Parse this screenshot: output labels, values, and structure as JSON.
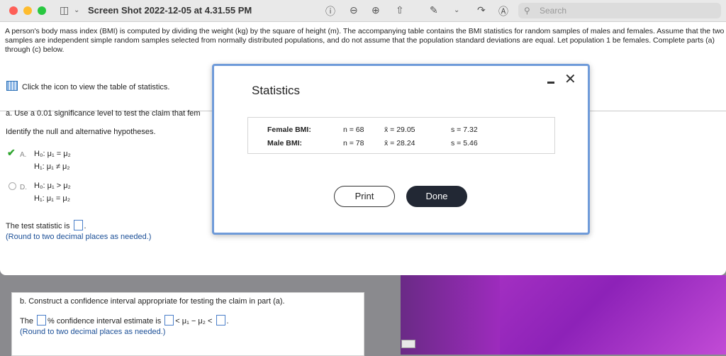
{
  "window": {
    "title": "Screen Shot 2022-12-05 at 4.31.55 PM",
    "search_placeholder": "Search"
  },
  "colors": {
    "close": "#fe5f57",
    "minimize": "#febc2e",
    "zoom": "#28c840"
  },
  "icons": [
    "sidebar-icon",
    "chevron-down-icon",
    "info-icon",
    "zoom-out-icon",
    "zoom-in-icon",
    "share-icon",
    "markup-icon",
    "rotate-icon",
    "annotate-icon",
    "search-icon"
  ],
  "intro": "A person's body mass index (BMI) is computed by dividing the weight (kg) by the square of height (m). The accompanying table contains the BMI statistics for random samples of males and females. Assume that the two samples are independent simple random samples selected from normally distributed populations, and do not assume that the population standard deviations are equal. Let population 1 be females. Complete parts (a) through (c) below.",
  "icon_link": "Click the icon to view the table of statistics.",
  "part_a": {
    "prompt": "a. Use a 0.01 significance level to test the claim that fem",
    "identify": "Identify the null and alternative hypotheses.",
    "optA_label": "A.",
    "optA_h0": "H₀: μ₁ = μ₂",
    "optA_h1": "H₁: μ₁ ≠ μ₂",
    "optD_label": "D.",
    "optD_h0": "H₀: μ₁ > μ₂",
    "optD_h1": "H₁: μ₁ = μ₂",
    "test_stat": "The test statistic is",
    "round": "(Round to two decimal places as needed.)"
  },
  "modal": {
    "title": "Statistics",
    "rows": [
      {
        "label": "Female BMI:",
        "n": "n = 68",
        "mean": "x̄ = 29.05",
        "sd": "s = 7.32"
      },
      {
        "label": "Male BMI:",
        "n": "n = 78",
        "mean": "x̄ = 28.24",
        "sd": "s = 5.46"
      }
    ],
    "print": "Print",
    "done": "Done",
    "close": "✕"
  },
  "part_b": {
    "prompt": "b. Construct a confidence interval appropriate for testing the claim in part (a).",
    "the": "The",
    "ci_text": "% confidence interval estimate is",
    "mid": "< μ₁ − μ₂ <",
    "round": "(Round to two decimal places as needed.)"
  }
}
